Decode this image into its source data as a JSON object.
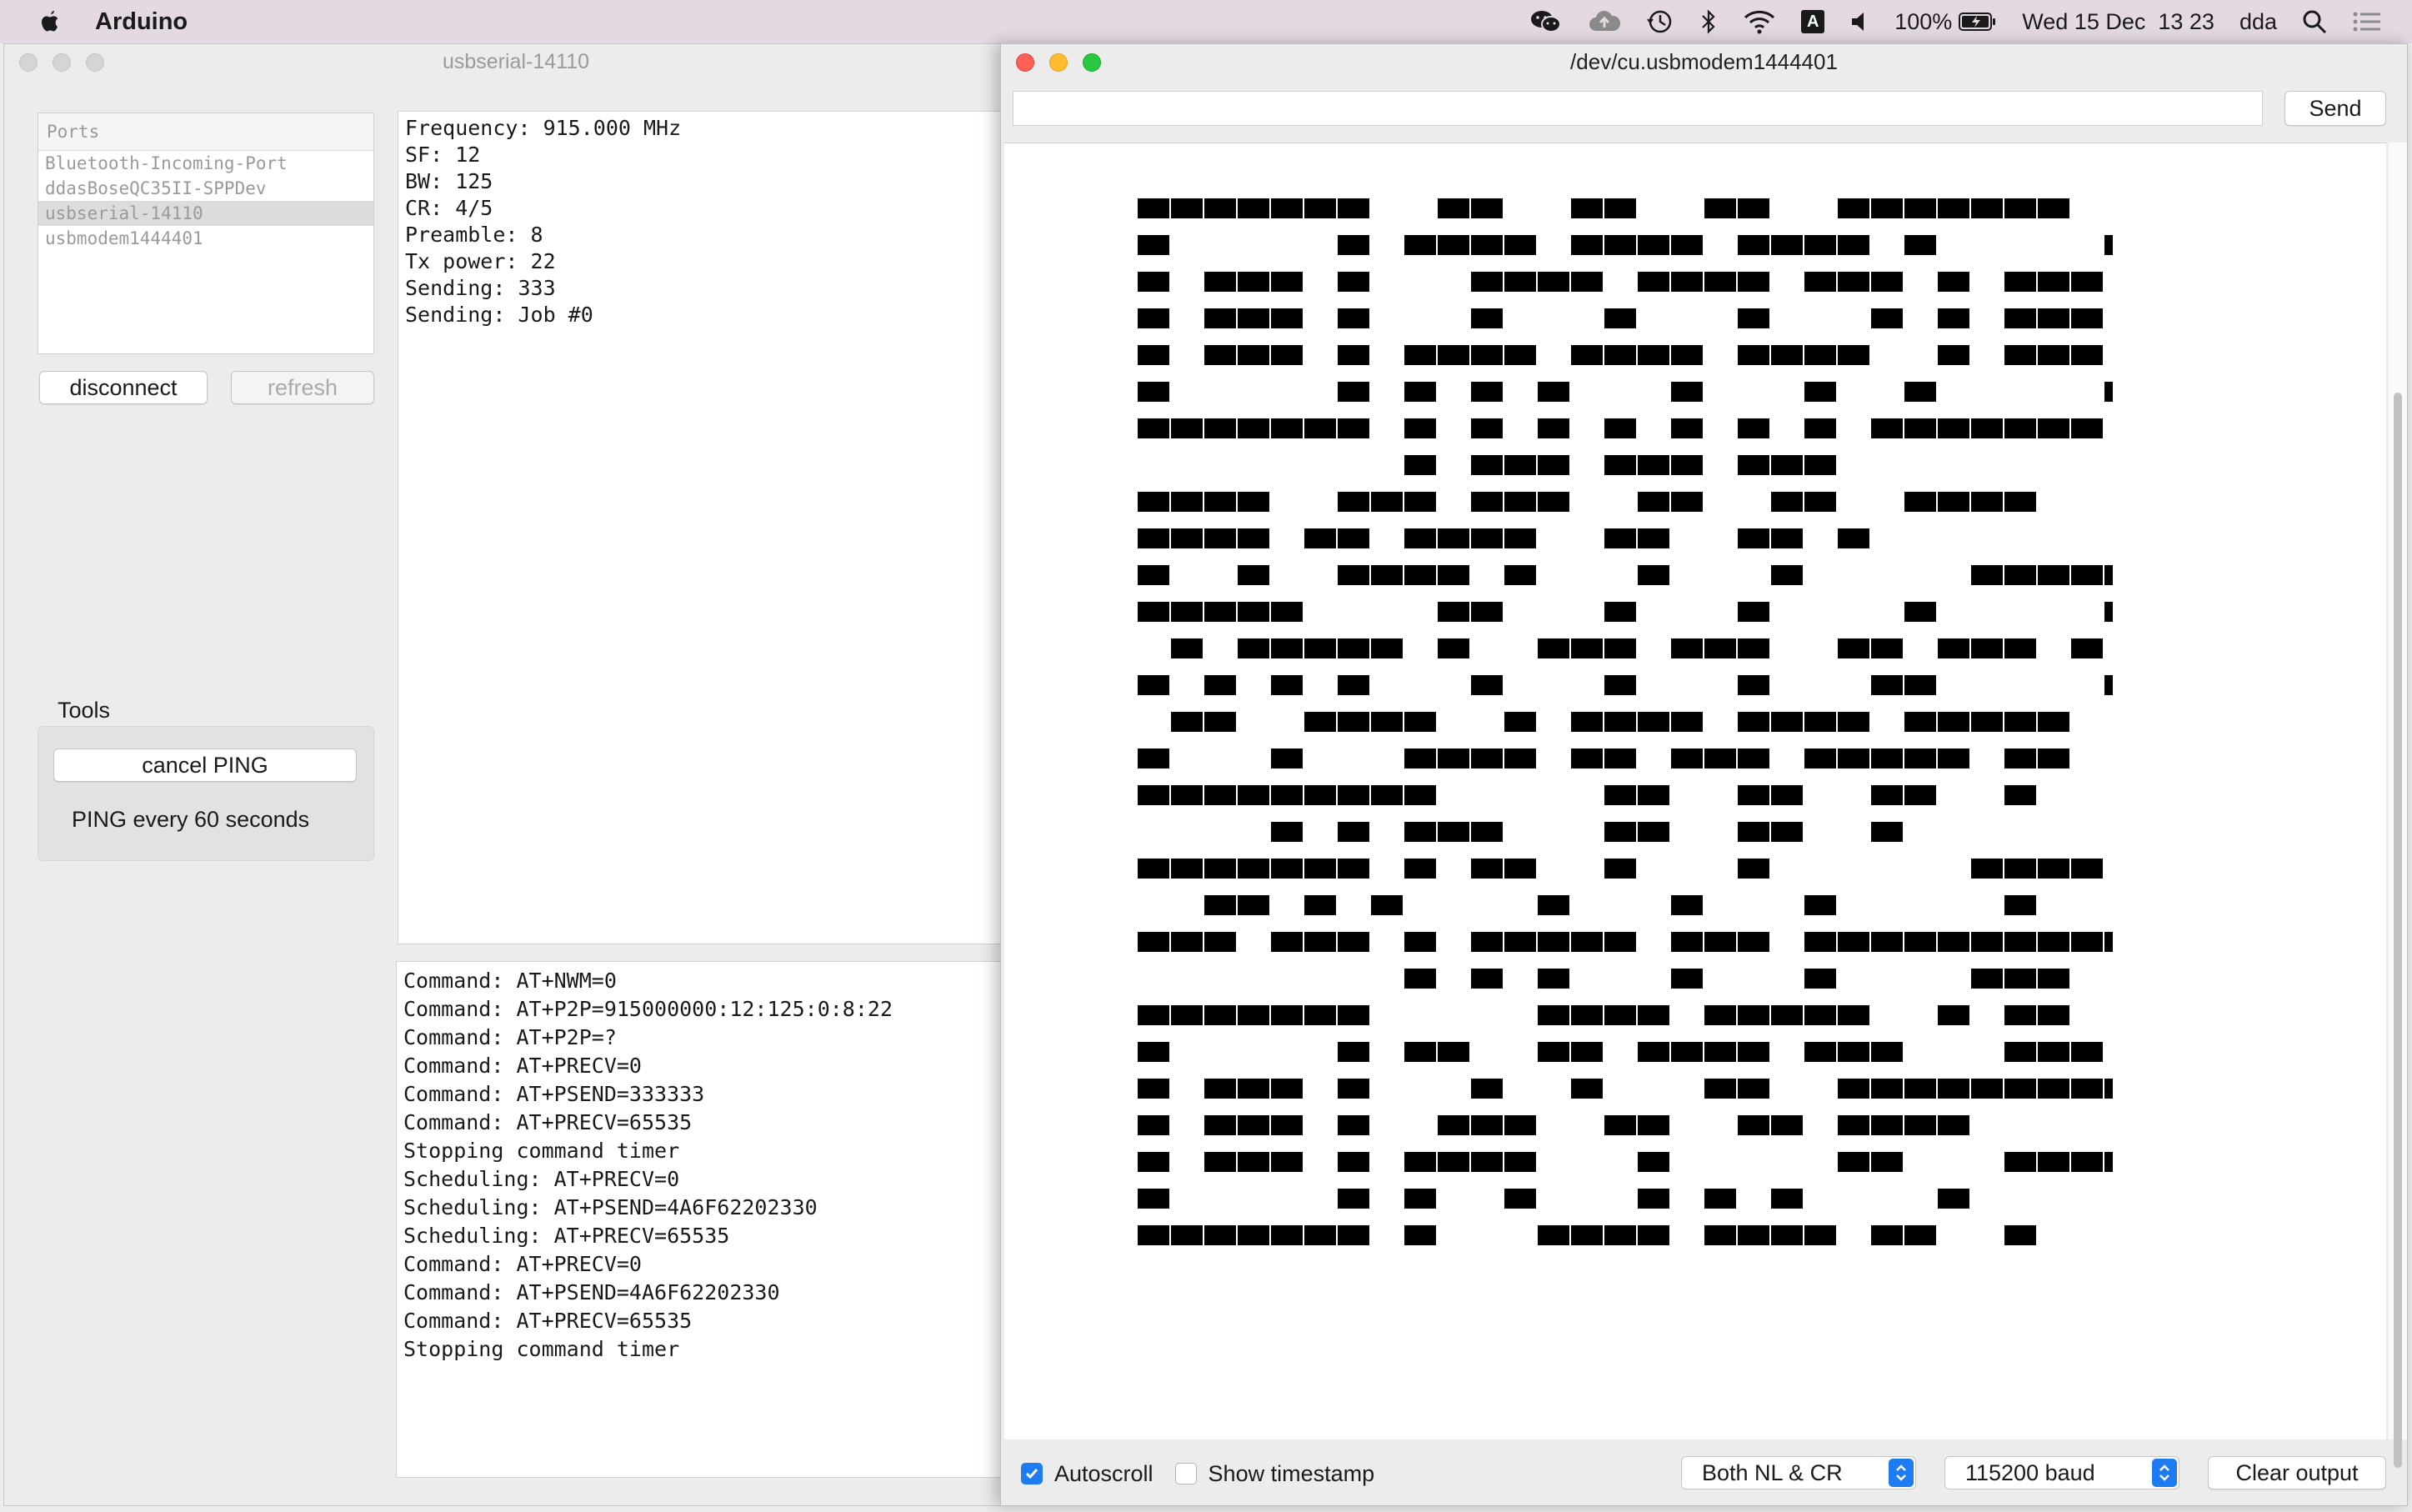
{
  "menubar": {
    "app_name": "Arduino",
    "battery": "100%",
    "datetime": "Wed 15 Dec  13 23",
    "user": "dda",
    "icons": [
      "apple-icon",
      "wechat-icon",
      "cloud-icon",
      "time-machine-icon",
      "bluetooth-icon",
      "wifi-icon",
      "input-source-icon",
      "volume-icon",
      "battery-icon",
      "search-icon",
      "control-center-icon"
    ]
  },
  "left_window": {
    "title": "usbserial-14110",
    "ports": {
      "header": "Ports",
      "items": [
        "Bluetooth-Incoming-Port",
        "ddasBoseQC35II-SPPDev",
        "usbserial-14110",
        "usbmodem1444401"
      ],
      "selected_index": 2
    },
    "disconnect_label": "disconnect",
    "refresh_label": "refresh",
    "tools": {
      "label": "Tools",
      "cancel_ping_label": "cancel PING",
      "ping_text": "PING every 60 seconds"
    },
    "status_lines": [
      "Frequency: 915.000 MHz",
      "SF: 12",
      "BW: 125",
      "CR: 4/5",
      "Preamble: 8",
      "Tx power: 22",
      "Sending: 333",
      "Sending: Job #0"
    ],
    "log_lines": [
      "Command: AT+NWM=0",
      "Command: AT+P2P=915000000:12:125:0:8:22",
      "Command: AT+P2P=?",
      "Command: AT+PRECV=0",
      "Command: AT+PSEND=333333",
      "Command: AT+PRECV=65535",
      "Stopping command timer",
      "Scheduling: AT+PRECV=0",
      "Scheduling: AT+PSEND=4A6F62202330",
      "Scheduling: AT+PRECV=65535",
      "Command: AT+PRECV=0",
      "Command: AT+PSEND=4A6F62202330",
      "Command: AT+PRECV=65535",
      "Stopping command timer"
    ]
  },
  "serial_monitor": {
    "title": "/dev/cu.usbmodem1444401",
    "input_value": "",
    "send_label": "Send",
    "autoscroll_label": "Autoscroll",
    "autoscroll_checked": true,
    "timestamp_label": "Show timestamp",
    "timestamp_checked": false,
    "line_ending": "Both NL & CR",
    "baud": "115200 baud",
    "clear_label": "Clear output",
    "qr_rows": [
      "111111100110011001100111111100000000",
      "100000101111011110111101000001000000",
      "101110100011110111101110101110100000",
      "101110100010001000100010101110100000",
      "101110101111011110111100101110100000",
      "100000101010100010001001000001000000",
      "111111101010101010101011111110000000",
      "000000001011101110111000000000000000",
      "111100111011100110011001111000110000",
      "111101101111001100110100000000100000",
      "100100111101000100010000011111100000",
      "111110000110001000100001000001000000",
      "010111110100111011100110111010100000",
      "101010100010001000100011000001000000",
      "011001111001011110111101111100010000",
      "100010001111011011101111101100111000",
      "111111111000001100110011001000000000",
      "000010101110001100110010000000100000",
      "111111101011001000100000011110100000",
      "001101010000100010001000001000100000",
      "111011101011111011101111111111000000",
      "000000001010100010001000011100000000",
      "111111100000111101111100101100100000",
      "100000101100110111101110001110100000",
      "101110100010010001100111111111100000",
      "101110100111001100110111100000000000",
      "101110101111000100000110001111000000",
      "100000101001000101010000100000000000",
      "111111101000111101111011001000101000"
    ]
  }
}
